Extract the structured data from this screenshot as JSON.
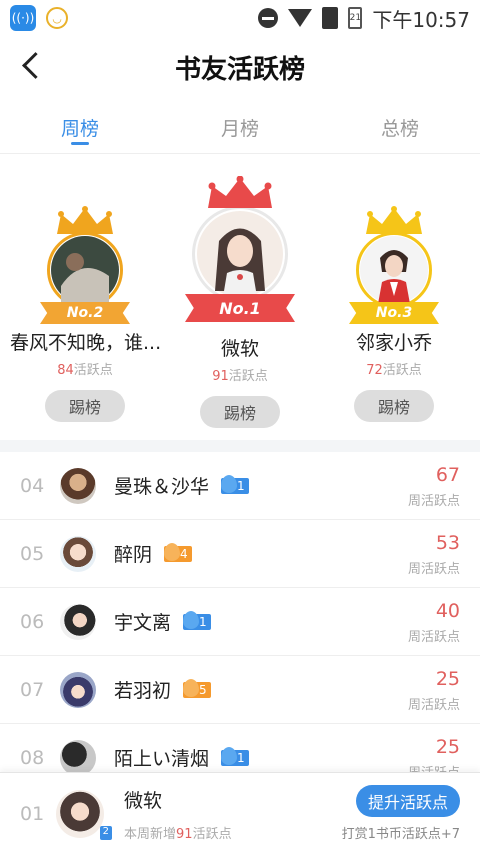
{
  "status_bar": {
    "time": "下午10:57",
    "battery": "21"
  },
  "header": {
    "title": "书友活跃榜"
  },
  "tabs": [
    {
      "label": "周榜",
      "active": true
    },
    {
      "label": "月榜",
      "active": false
    },
    {
      "label": "总榜",
      "active": false
    }
  ],
  "podium": [
    {
      "place_label": "No.2",
      "name": "春风不知晚，谁...",
      "points": "84",
      "points_suffix": "活跃点",
      "button": "踢榜"
    },
    {
      "place_label": "No.1",
      "name": "微软",
      "points": "91",
      "points_suffix": "活跃点",
      "button": "踢榜"
    },
    {
      "place_label": "No.3",
      "name": "邻家小乔",
      "points": "72",
      "points_suffix": "活跃点",
      "button": "踢榜"
    }
  ],
  "list": [
    {
      "rank": "04",
      "name": "曼珠＆沙华",
      "level": "1",
      "level_color": "blue",
      "score": "67",
      "unit": "周活跃点"
    },
    {
      "rank": "05",
      "name": "醉阴",
      "level": "4",
      "level_color": "orange",
      "score": "53",
      "unit": "周活跃点"
    },
    {
      "rank": "06",
      "name": "宇文离",
      "level": "1",
      "level_color": "blue",
      "score": "40",
      "unit": "周活跃点"
    },
    {
      "rank": "07",
      "name": "若羽初",
      "level": "5",
      "level_color": "orange",
      "score": "25",
      "unit": "周活跃点"
    },
    {
      "rank": "08",
      "name": "陌上い清烟",
      "level": "1",
      "level_color": "blue",
      "score": "25",
      "unit": "周活跃点"
    }
  ],
  "me": {
    "rank": "01",
    "name": "微软",
    "level": "2",
    "sub_prefix": "本周新增",
    "sub_points": "91",
    "sub_suffix": "活跃点",
    "button": "提升活跃点",
    "tip": "打赏1书币活跃点+7"
  },
  "colors": {
    "accent": "#3a8ee6",
    "score": "#e0605e",
    "gold": "#f0a51e",
    "red": "#e84a4a"
  }
}
